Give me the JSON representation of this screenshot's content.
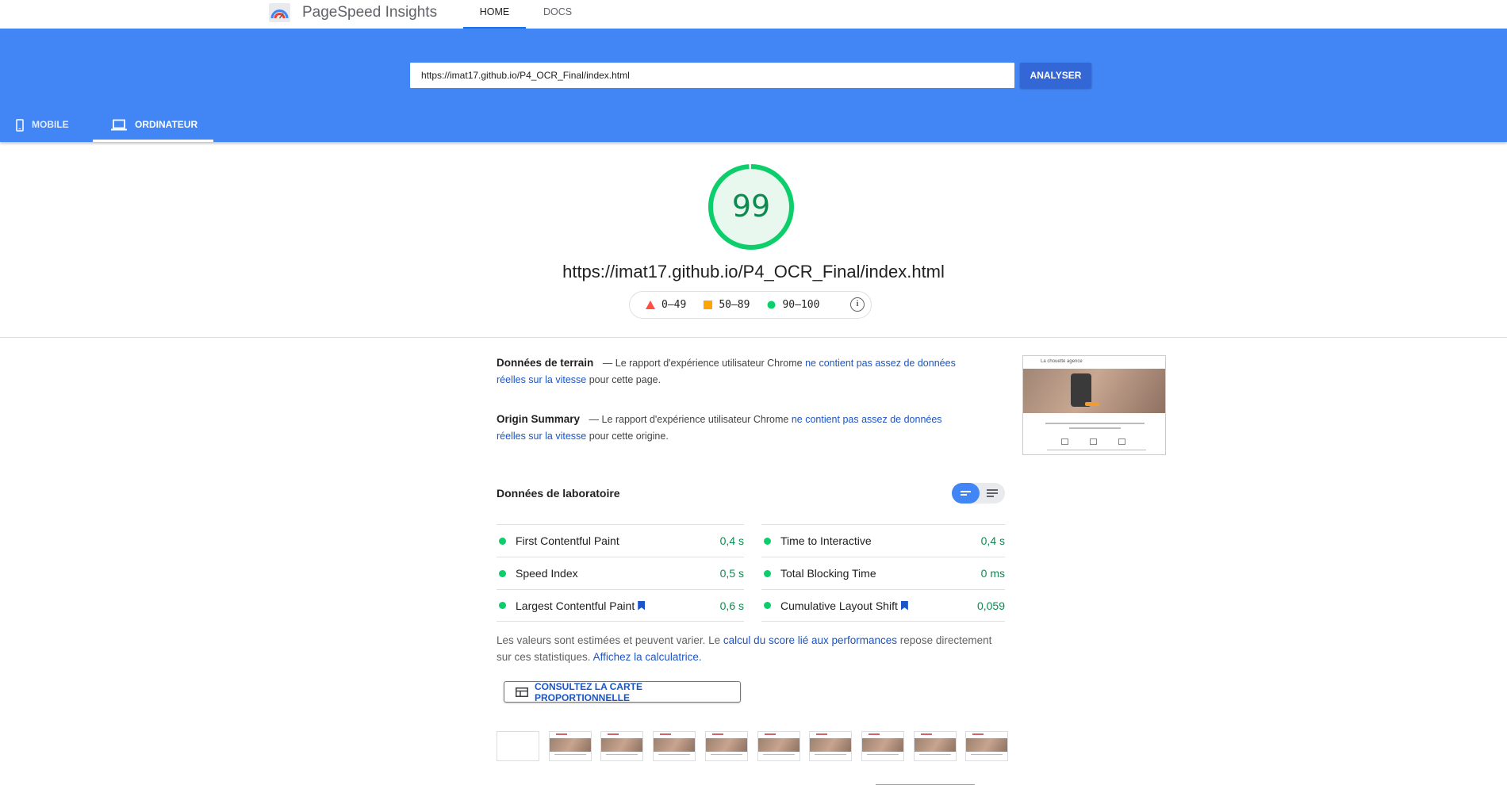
{
  "header": {
    "app_title": "PageSpeed Insights",
    "nav": [
      {
        "label": "HOME",
        "active": true
      },
      {
        "label": "DOCS",
        "active": false
      }
    ]
  },
  "search": {
    "url_value": "https://imat17.github.io/P4_OCR_Final/index.html",
    "analyse_label": "ANALYSER"
  },
  "device_tabs": [
    {
      "label": "MOBILE",
      "icon": "phone-icon",
      "active": false
    },
    {
      "label": "ORDINATEUR",
      "icon": "laptop-icon",
      "active": true
    }
  ],
  "score": {
    "value": "99",
    "value_number": 99,
    "url": "https://imat17.github.io/P4_OCR_Final/index.html",
    "color": "#0cce6b"
  },
  "legend": [
    {
      "label": "0–49",
      "shape": "triangle",
      "color": "#ff4e42"
    },
    {
      "label": "50–89",
      "shape": "square",
      "color": "#ffa400"
    },
    {
      "label": "90–100",
      "shape": "circle",
      "color": "#0cce6b"
    }
  ],
  "field_data": {
    "title": "Données de terrain",
    "text_before": "— Le rapport d'expérience utilisateur Chrome",
    "link": "ne contient pas assez de données réelles sur la vitesse",
    "text_after": "pour cette page."
  },
  "origin_summary": {
    "title": "Origin Summary",
    "text_before": "— Le rapport d'expérience utilisateur Chrome",
    "link": "ne contient pas assez de données réelles sur la vitesse",
    "text_after": "pour cette origine."
  },
  "thumbnail": {
    "logo_text": "La chouette agence"
  },
  "lab": {
    "title": "Données de laboratoire",
    "metrics": [
      {
        "name": "First Contentful Paint",
        "value": "0,4 s",
        "flag": false
      },
      {
        "name": "Time to Interactive",
        "value": "0,4 s",
        "flag": false
      },
      {
        "name": "Speed Index",
        "value": "0,5 s",
        "flag": false
      },
      {
        "name": "Total Blocking Time",
        "value": "0 ms",
        "flag": false
      },
      {
        "name": "Largest Contentful Paint",
        "value": "0,6 s",
        "flag": true
      },
      {
        "name": "Cumulative Layout Shift",
        "value": "0,059",
        "flag": true
      }
    ],
    "note_text_1": "Les valeurs sont estimées et peuvent varier. Le",
    "note_link_1": "calcul du score lié aux performances",
    "note_text_2": "repose directement sur ces statistiques.",
    "note_link_2": "Affichez la calculatrice.",
    "map_button_label": "CONSULTEZ LA CARTE PROPORTIONNELLE"
  },
  "filmstrip": {
    "frame_count": 10
  },
  "colors": {
    "brand_blue": "#4285f4",
    "button_blue": "#3367d6",
    "link_blue": "#1a55c9",
    "pass_green": "#0cce6b"
  }
}
